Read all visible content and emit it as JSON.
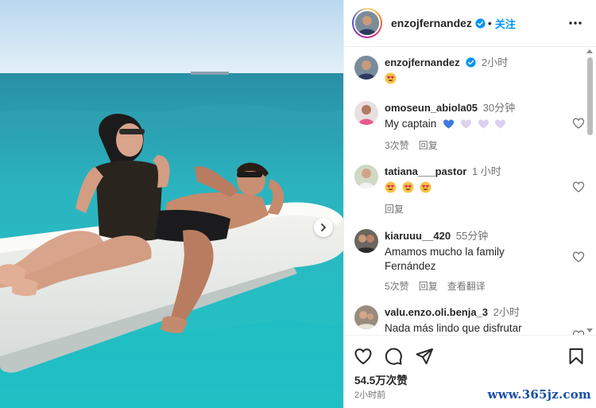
{
  "post": {
    "author": "enzojfernandez",
    "follow_label": "关注",
    "dot": "•",
    "likes": "54.5万次赞",
    "posted_time": "2小时前"
  },
  "comments": [
    {
      "user": "enzojfernandez",
      "time": "2小时",
      "text": "",
      "emojis": [
        "heart-eyes-face"
      ],
      "meta": []
    },
    {
      "user": "omoseun_abiola05",
      "time": "30分钟",
      "text": "My captain",
      "emojis": [
        "blue-heart",
        "lilac-heart",
        "lilac-heart",
        "lilac-heart"
      ],
      "meta": [
        "3次赞",
        "回复"
      ]
    },
    {
      "user": "tatiana___pastor",
      "time": "1 小时",
      "text": "",
      "emojis": [
        "heart-eyes-face",
        "heart-eyes-face",
        "heart-eyes-face"
      ],
      "meta": [
        "回复"
      ]
    },
    {
      "user": "kiaruuu__420",
      "time": "55分钟",
      "text": "Amamos mucho la family Fernández",
      "emojis": [],
      "meta": [
        "5次赞",
        "回复",
        "查看翻译"
      ]
    },
    {
      "user": "valu.enzo.oli.benja_3",
      "time": "2小时",
      "text": "Nada más lindo que disfrutar",
      "emojis": [],
      "meta": []
    }
  ],
  "watermark": "www.365jz.com",
  "colors": {
    "accent": "#0095f6",
    "sea": "#27b3be",
    "sky": "#cfe6f5",
    "muted": "#737373"
  },
  "icons": [
    "verified-badge-icon",
    "more-options-icon",
    "next-arrow-icon",
    "heart-icon",
    "comment-icon",
    "share-icon",
    "bookmark-icon"
  ]
}
